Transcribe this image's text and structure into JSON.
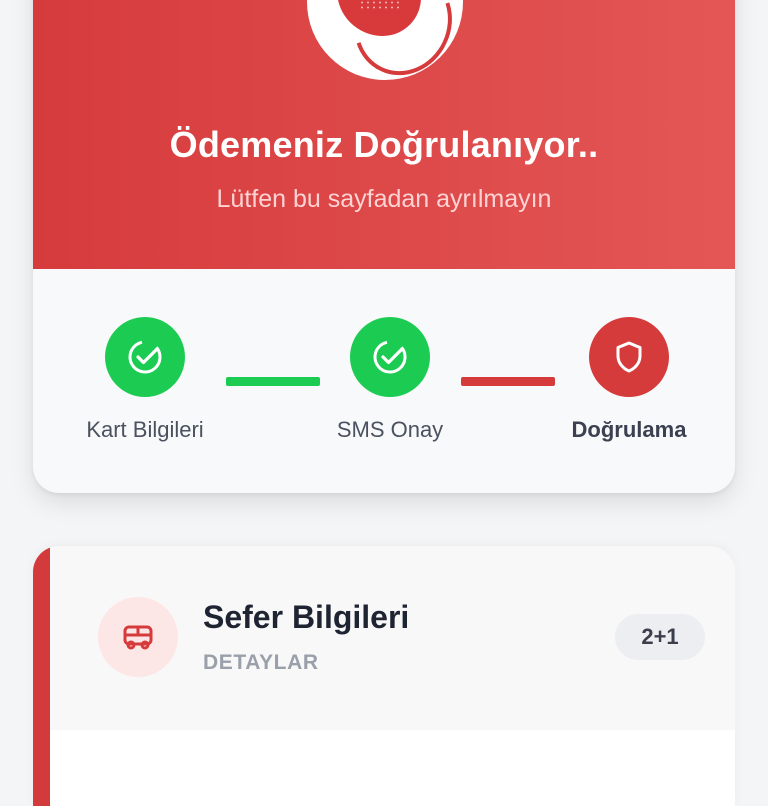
{
  "verification": {
    "title": "Ödemeniz Doğrulanıyor..",
    "subtitle": "Lütfen bu sayfadan ayrılmayın",
    "colors": {
      "primary": "#d63b3c",
      "success": "#1ccc52"
    }
  },
  "steps": [
    {
      "label": "Kart Bilgileri",
      "status": "done",
      "icon": "check-circle-icon"
    },
    {
      "label": "SMS Onay",
      "status": "done",
      "icon": "check-circle-icon"
    },
    {
      "label": "Doğrulama",
      "status": "active",
      "icon": "shield-icon"
    }
  ],
  "trip": {
    "title": "Sefer Bilgileri",
    "subtitle": "DETAYLAR",
    "seat_layout": "2+1",
    "icon": "bus-icon"
  }
}
